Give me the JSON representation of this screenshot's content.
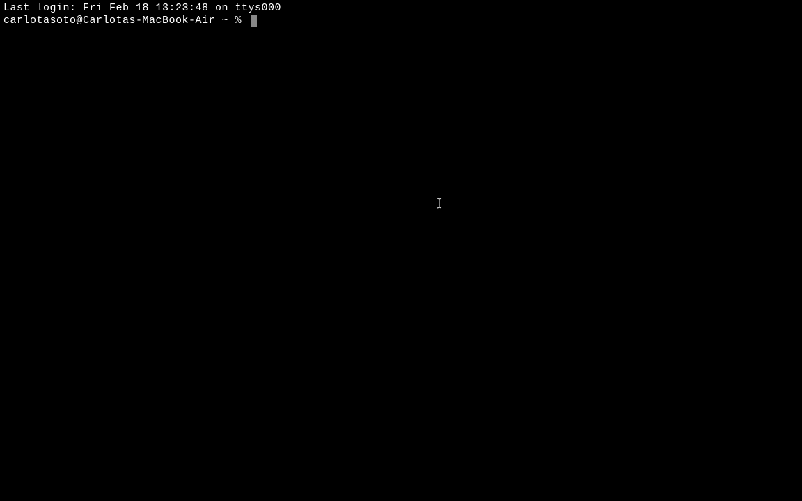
{
  "terminal": {
    "last_login_line": "Last login: Fri Feb 18 13:23:48 on ttys000",
    "prompt": "carlotasoto@Carlotas-MacBook-Air ~ % "
  }
}
